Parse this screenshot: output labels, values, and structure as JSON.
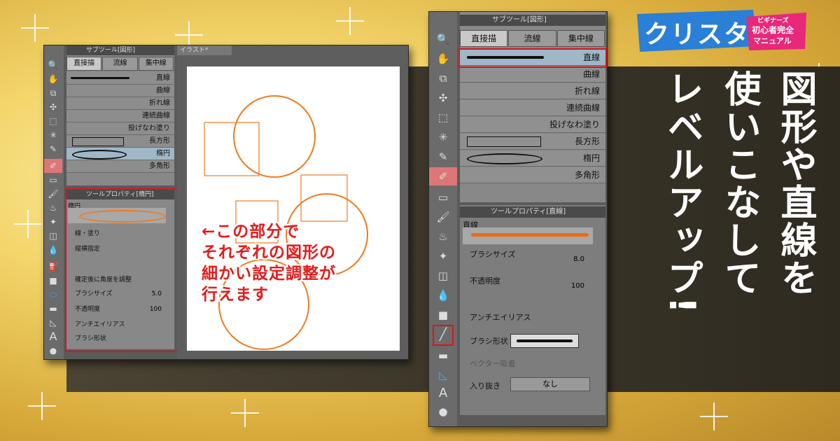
{
  "logo": {
    "main": "クリスタ",
    "badge_line1": "ビギナーズ",
    "badge_line2": "初心者完全",
    "badge_line3": "マニュアル"
  },
  "headline": {
    "col1": "図形や直線を",
    "col2": "使いこなして",
    "col3": "レベルアップ!"
  },
  "annotation": {
    "line1": "←この部分で",
    "line2": "それぞれの図形の",
    "line3": "細かい設定調整が",
    "line4": "行えます"
  },
  "left": {
    "subtool_title": "サブツール[図形]",
    "canvas_tab": "イラスト*",
    "tabs": [
      "直接描",
      "流線",
      "集中線"
    ],
    "items": [
      "直線",
      "曲線",
      "折れ線",
      "連続曲線",
      "投げなわ塗り",
      "長方形",
      "楕円",
      "多角形"
    ],
    "prop_title": "ツールプロパティ[楕円]",
    "prop_name": "楕円",
    "props": [
      "線・塗り",
      "縦横指定",
      "確定後に角度を調整",
      "ブラシサイズ",
      "不透明度",
      "アンチエイリアス",
      "ブラシ形状"
    ],
    "brush_size": "5.0",
    "opacity": "100"
  },
  "right": {
    "subtool_title": "サブツール[図形]",
    "tabs": [
      "直接描",
      "流線",
      "集中線"
    ],
    "items": [
      "直線",
      "曲線",
      "折れ線",
      "連続曲線",
      "投げなわ塗り",
      "長方形",
      "楕円",
      "多角形"
    ],
    "prop_title": "ツールプロパティ[直線]",
    "prop_name": "直線",
    "brush_size_label": "ブラシサイズ",
    "brush_size": "8.0",
    "opacity_label": "不透明度",
    "opacity": "100",
    "aa_label": "アンチエイリアス",
    "shape_label": "ブラシ形状",
    "vector_label": "ベクター吸着",
    "entry_label": "入り抜き",
    "entry_value": "なし"
  },
  "colors": {
    "accent": "#e0121c",
    "stroke": "#f07a1e"
  }
}
